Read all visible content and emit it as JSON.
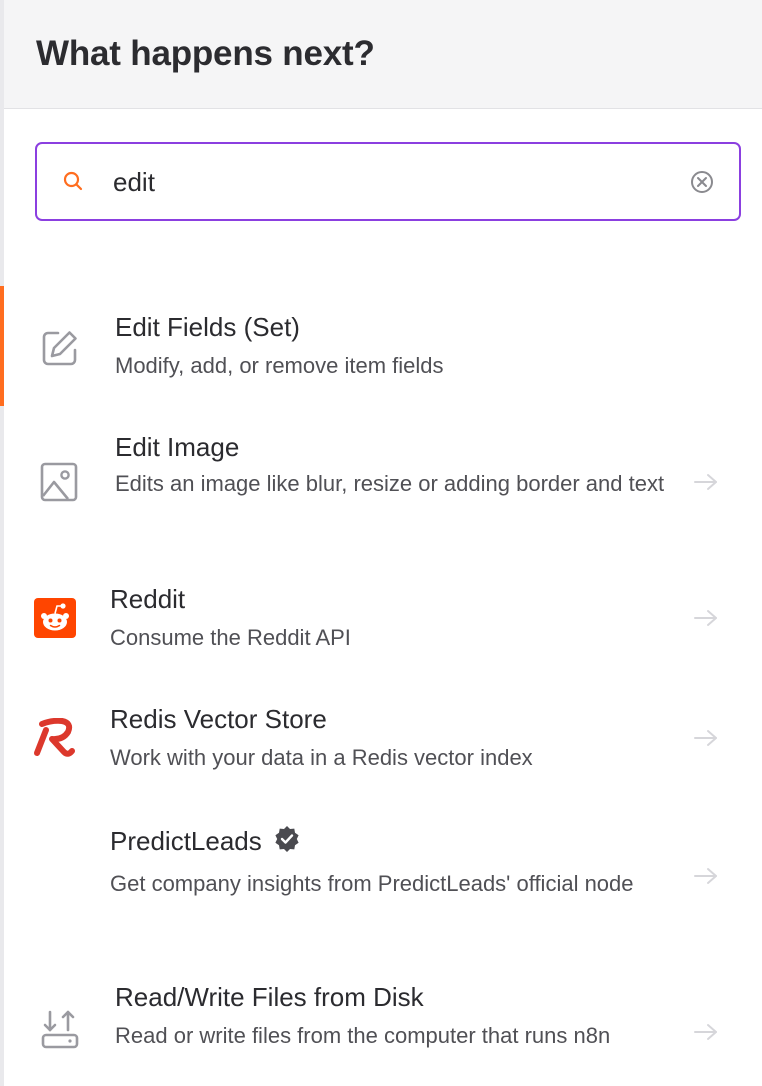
{
  "header": {
    "title": "What happens next?"
  },
  "search": {
    "value": "edit",
    "placeholder": ""
  },
  "results": [
    {
      "title": "Edit Fields (Set)",
      "description": "Modify, add, or remove item fields",
      "icon": "edit-pencil-icon",
      "active": true
    },
    {
      "title": "Edit Image",
      "description": "Edits an image like blur, resize or adding border and text",
      "icon": "image-icon"
    },
    {
      "title": "Reddit",
      "description": "Consume the Reddit API",
      "icon": "reddit-logo-icon"
    },
    {
      "title": "Redis Vector Store",
      "description": "Work with your data in a Redis vector index",
      "icon": "redis-logo-icon"
    },
    {
      "title": "PredictLeads",
      "description": "Get company insights from PredictLeads' official node",
      "icon": "none",
      "verified": true
    },
    {
      "title": "Read/Write Files from Disk",
      "description": "Read or write files from the computer that runs n8n",
      "icon": "file-transfer-icon"
    }
  ],
  "colors": {
    "accent_border": "#8b3fe0",
    "active_bar": "#ff6d1f",
    "search_icon": "#ff6d1f",
    "reddit": "#ff4500",
    "redis": "#dc382c"
  }
}
